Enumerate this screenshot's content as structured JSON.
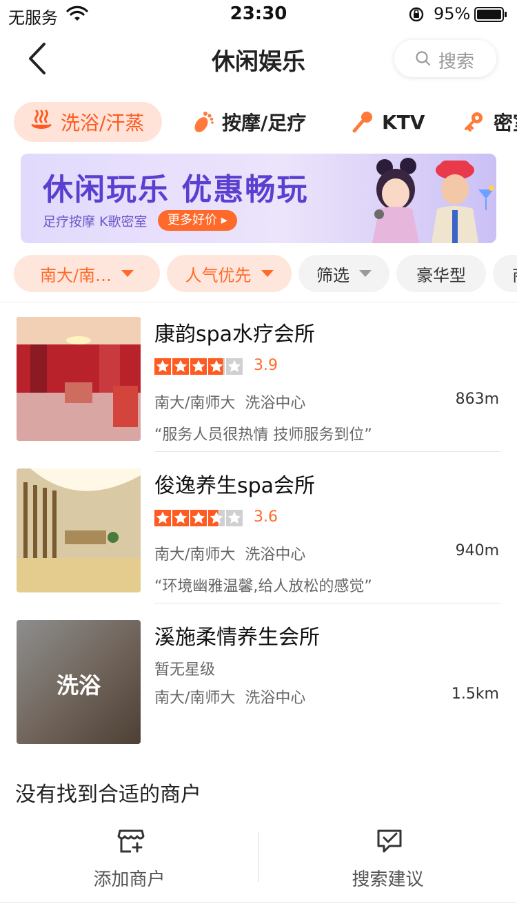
{
  "status": {
    "carrier": "无服务",
    "time": "23:30",
    "battery": "95%"
  },
  "nav": {
    "title": "休闲娱乐",
    "search_label": "搜索"
  },
  "categories": [
    {
      "label": "洗浴/汗蒸",
      "icon": "hot-spring-icon",
      "active": true
    },
    {
      "label": "按摩/足疗",
      "icon": "foot-icon",
      "active": false
    },
    {
      "label": "KTV",
      "icon": "microphone-icon",
      "active": false
    },
    {
      "label": "密室",
      "icon": "key-icon",
      "active": false
    }
  ],
  "banner": {
    "title": "休闲玩乐 优惠畅玩",
    "subtitle": "足疗按摩 K歌密室",
    "cta": "更多好价"
  },
  "filters": [
    {
      "label": "南大/南…",
      "style": "orange",
      "dropdown": true
    },
    {
      "label": "人气优先",
      "style": "orange",
      "dropdown": true
    },
    {
      "label": "筛选",
      "style": "gray",
      "dropdown": true
    },
    {
      "label": "豪华型",
      "style": "gray",
      "dropdown": false
    },
    {
      "label": "商",
      "style": "gray",
      "dropdown": false
    }
  ],
  "listings": [
    {
      "name": "康韵spa水疗会所",
      "rating": 3.9,
      "rating_text": "3.9",
      "area": "南大/南师大",
      "type": "洗浴中心",
      "distance": "863m",
      "review": "“服务人员很热情 技师服务到位”"
    },
    {
      "name": "俊逸养生spa会所",
      "rating": 3.6,
      "rating_text": "3.6",
      "area": "南大/南师大",
      "type": "洗浴中心",
      "distance": "940m",
      "review": "“环境幽雅温馨,给人放松的感觉”"
    },
    {
      "name": "溪施柔情养生会所",
      "no_rating": "暂无星级",
      "area": "南大/南师大",
      "type": "洗浴中心",
      "distance": "1.5km",
      "thumb_label": "洗浴"
    }
  ],
  "footer": {
    "not_found": "没有找到合适的商户",
    "add_merchant": "添加商户",
    "suggest": "搜索建议"
  },
  "colors": {
    "accent": "#ff6a2b",
    "star": "#ff5a1f",
    "star_empty": "#d0d0d0"
  }
}
